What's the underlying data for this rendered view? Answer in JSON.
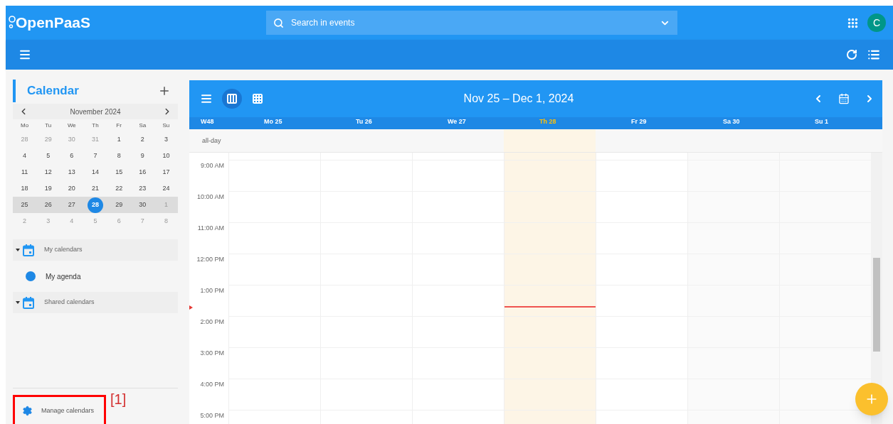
{
  "app": {
    "logo": "OpenPaaS",
    "search": {
      "placeholder": "Search in events"
    },
    "avatar": "C"
  },
  "sidebar": {
    "title": "Calendar",
    "mini_calendar": {
      "month": "November 2024",
      "weekdays": [
        "Mo",
        "Tu",
        "We",
        "Th",
        "Fr",
        "Sa",
        "Su"
      ],
      "weeks": [
        {
          "selected": false,
          "days": [
            {
              "label": "28",
              "muted": true,
              "today": false
            },
            {
              "label": "29",
              "muted": true,
              "today": false
            },
            {
              "label": "30",
              "muted": true,
              "today": false
            },
            {
              "label": "31",
              "muted": true,
              "today": false
            },
            {
              "label": "1",
              "muted": false,
              "today": false
            },
            {
              "label": "2",
              "muted": false,
              "today": false
            },
            {
              "label": "3",
              "muted": false,
              "today": false
            }
          ]
        },
        {
          "selected": false,
          "days": [
            {
              "label": "4",
              "muted": false,
              "today": false
            },
            {
              "label": "5",
              "muted": false,
              "today": false
            },
            {
              "label": "6",
              "muted": false,
              "today": false
            },
            {
              "label": "7",
              "muted": false,
              "today": false
            },
            {
              "label": "8",
              "muted": false,
              "today": false
            },
            {
              "label": "9",
              "muted": false,
              "today": false
            },
            {
              "label": "10",
              "muted": false,
              "today": false
            }
          ]
        },
        {
          "selected": false,
          "days": [
            {
              "label": "11",
              "muted": false,
              "today": false
            },
            {
              "label": "12",
              "muted": false,
              "today": false
            },
            {
              "label": "13",
              "muted": false,
              "today": false
            },
            {
              "label": "14",
              "muted": false,
              "today": false
            },
            {
              "label": "15",
              "muted": false,
              "today": false
            },
            {
              "label": "16",
              "muted": false,
              "today": false
            },
            {
              "label": "17",
              "muted": false,
              "today": false
            }
          ]
        },
        {
          "selected": false,
          "days": [
            {
              "label": "18",
              "muted": false,
              "today": false
            },
            {
              "label": "19",
              "muted": false,
              "today": false
            },
            {
              "label": "20",
              "muted": false,
              "today": false
            },
            {
              "label": "21",
              "muted": false,
              "today": false
            },
            {
              "label": "22",
              "muted": false,
              "today": false
            },
            {
              "label": "23",
              "muted": false,
              "today": false
            },
            {
              "label": "24",
              "muted": false,
              "today": false
            }
          ]
        },
        {
          "selected": true,
          "days": [
            {
              "label": "25",
              "muted": false,
              "today": false
            },
            {
              "label": "26",
              "muted": false,
              "today": false
            },
            {
              "label": "27",
              "muted": false,
              "today": false
            },
            {
              "label": "28",
              "muted": false,
              "today": true
            },
            {
              "label": "29",
              "muted": false,
              "today": false
            },
            {
              "label": "30",
              "muted": false,
              "today": false
            },
            {
              "label": "1",
              "muted": true,
              "today": false
            }
          ]
        },
        {
          "selected": false,
          "days": [
            {
              "label": "2",
              "muted": true,
              "today": false
            },
            {
              "label": "3",
              "muted": true,
              "today": false
            },
            {
              "label": "4",
              "muted": true,
              "today": false
            },
            {
              "label": "5",
              "muted": true,
              "today": false
            },
            {
              "label": "6",
              "muted": true,
              "today": false
            },
            {
              "label": "7",
              "muted": true,
              "today": false
            },
            {
              "label": "8",
              "muted": true,
              "today": false
            }
          ]
        }
      ]
    },
    "groups": [
      {
        "label": "My calendars",
        "expanded": true,
        "calendars": [
          {
            "name": "My agenda",
            "color": "#1e88e5"
          }
        ]
      },
      {
        "label": "Shared calendars",
        "expanded": true
      }
    ],
    "manage": "Manage calendars"
  },
  "annotation": {
    "label": "[1]"
  },
  "calendar": {
    "views": [
      {
        "kind": "list",
        "selected": false
      },
      {
        "kind": "week",
        "selected": true
      },
      {
        "kind": "month",
        "selected": false
      }
    ],
    "range": "Nov 25 – Dec 1, 2024",
    "week": "W48",
    "days": [
      {
        "label": "Mo 25",
        "today": false
      },
      {
        "label": "Tu 26",
        "today": false
      },
      {
        "label": "We 27",
        "today": false
      },
      {
        "label": "Th 28",
        "today": true
      },
      {
        "label": "Fr 29",
        "today": false
      },
      {
        "label": "Sa 30",
        "today": false
      },
      {
        "label": "Su 1",
        "today": false
      }
    ],
    "all_day": "all-day",
    "hours": [
      "9:00 AM",
      "10:00 AM",
      "11:00 AM",
      "12:00 PM",
      "1:00 PM",
      "2:00 PM",
      "3:00 PM",
      "4:00 PM",
      "5:00 PM"
    ],
    "now": {
      "level": 0.43
    }
  }
}
